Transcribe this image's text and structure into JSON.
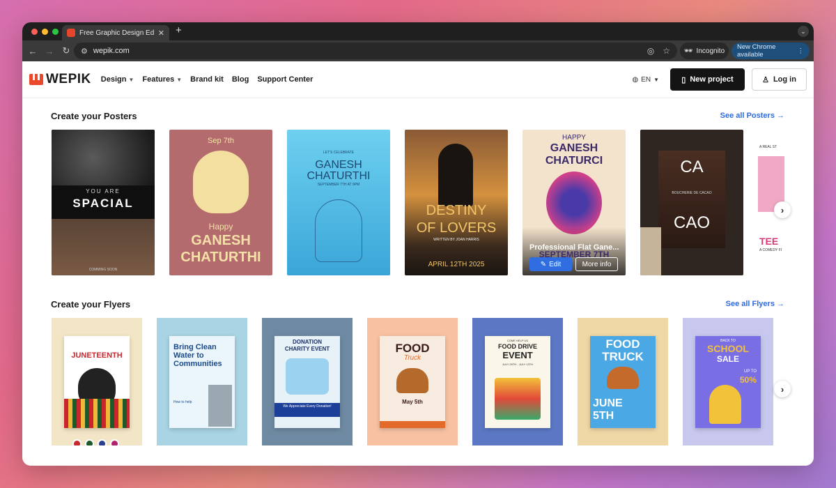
{
  "browser": {
    "tab_title": "Free Graphic Design Editor &",
    "url": "wepik.com",
    "incognito_label": "Incognito",
    "update_label": "New Chrome available"
  },
  "header": {
    "logo_text": "WEPIK",
    "nav": [
      {
        "label": "Design",
        "dropdown": true
      },
      {
        "label": "Features",
        "dropdown": true
      },
      {
        "label": "Brand kit",
        "dropdown": false
      },
      {
        "label": "Blog",
        "dropdown": false
      },
      {
        "label": "Support Center",
        "dropdown": false
      }
    ],
    "language": "EN",
    "new_project_label": "New project",
    "login_label": "Log in"
  },
  "posters": {
    "title": "Create your Posters",
    "see_all": "See all Posters →",
    "items": [
      {
        "title": "YOU ARE SPACIAL",
        "line1": "YOU ARE",
        "line2": "SPACIAL",
        "tag": "COMMING SOON"
      },
      {
        "date": "Sep 7th",
        "line1": "Happy",
        "line2": "GANESH",
        "line3": "CHATURTHI"
      },
      {
        "kicker": "LET'S CELEBRATE",
        "line1": "GANESH",
        "line2": "CHATURTHI",
        "date": "SEPTEMBER 7TH AT 9PM"
      },
      {
        "line1": "DESTINY",
        "line2": "OF LOVERS",
        "author": "WRITTEN BY JOAN HARRIS",
        "date": "APRIL 12TH 2025"
      },
      {
        "line0": "HAPPY",
        "line1": "GANESH",
        "line2": "CHATURCI",
        "hover_title": "Professional Flat Gane...",
        "date": "SEPTEMBER 7TH",
        "edit_label": "Edit",
        "more_label": "More info"
      },
      {
        "line1": "CA",
        "line2": "CAO",
        "caption": "BOUCHERIE DE CACAO"
      },
      {
        "line1": "TEE",
        "kicker": "A REAL ST",
        "caption": "A COMEDY FI"
      }
    ]
  },
  "flyers": {
    "title": "Create your Flyers",
    "see_all": "See all Flyers →",
    "items": [
      {
        "line1": "JUNETEENTH"
      },
      {
        "line1": "Bring Clean",
        "line2": "Water to",
        "line3": "Communities",
        "sub": "How to help"
      },
      {
        "line1": "DONATION",
        "line2": "CHARITY EVENT",
        "footer": "We Appreciate Every Donation!"
      },
      {
        "line1": "FOOD",
        "line2": "Truck",
        "date": "May 5th"
      },
      {
        "kicker": "COME HELP US",
        "line1": "FOOD DRIVE",
        "line2": "EVENT",
        "date": "JULY 25TH - JULY 13TH"
      },
      {
        "line1": "FOOD",
        "line2": "TRUCK",
        "line3": "JUNE",
        "line4": "5TH"
      },
      {
        "kicker": "BACK TO",
        "line1": "SCHOOL",
        "line2": "SALE",
        "line3": "UP TO",
        "line4": "50%"
      }
    ],
    "swatches": [
      "#c7282e",
      "#1d5a2a",
      "#2b3f8f",
      "#b0246d"
    ]
  },
  "colors": {
    "accent": "#2c6be0",
    "brand": "#ea4a2b"
  }
}
